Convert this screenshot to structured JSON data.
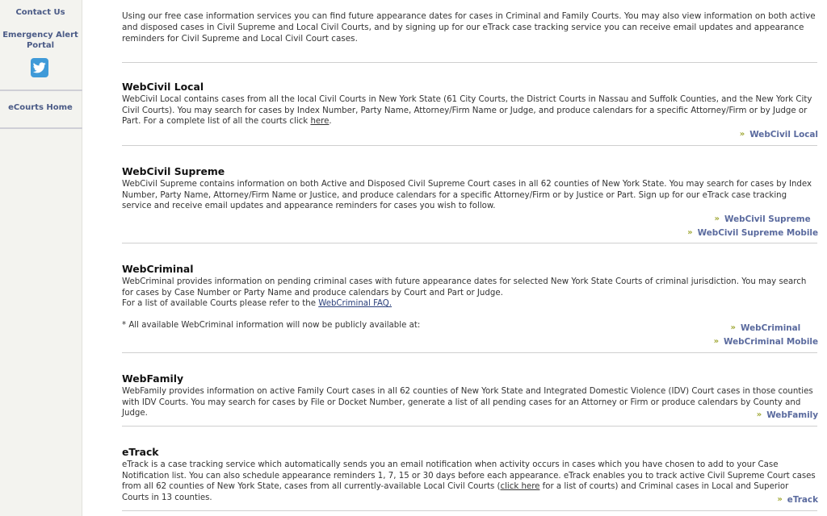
{
  "sidebar": {
    "contact_label": "Contact Us",
    "emergency_label": "Emergency Alert Portal",
    "twitter_icon": "twitter-bird-icon",
    "ecourts_label": "eCourts Home"
  },
  "intro_text": "Using our free case information services you can find future appearance dates for cases in Criminal and Family Courts. You may also view information on both active and disposed cases in Civil Supreme and Local Civil Courts, and by signing up for our eTrack case tracking service you can receive email updates and appearance reminders for Civil Supreme and Local Civil Court cases.",
  "sections": {
    "webcivil_local": {
      "title": "WebCivil Local",
      "body": "WebCivil Local contains cases from all the local Civil Courts in New York State (61 City Courts, the District Courts in Nassau and Suffolk Counties, and the New York City Civil Courts). You may search for cases by Index Number, Party Name, Attorney/Firm Name or Judge, and produce calendars for a specific Attorney/Firm or by Judge or Part. For a complete list of all the courts click ",
      "here_link": "here",
      "body_end": ".",
      "links": [
        "WebCivil Local"
      ]
    },
    "webcivil_supreme": {
      "title": "WebCivil Supreme",
      "body": "WebCivil Supreme contains information on both Active and Disposed Civil Supreme Court cases in all 62 counties of New York State. You may search for cases by Index Number, Party Name, Attorney/Firm Name or Justice, and produce calendars for a specific Attorney/Firm or by Justice or Part. Sign up for our eTrack case tracking service and receive email updates and appearance reminders for cases you wish to follow.",
      "links": [
        "WebCivil Supreme",
        "WebCivil Supreme Mobile"
      ]
    },
    "webcriminal": {
      "title": "WebCriminal",
      "body": "WebCriminal provides information on pending criminal cases with future appearance dates for selected New York State Courts of criminal jurisdiction. You may search for cases by Case Number or Party Name and produce calendars by Court and Part or Judge.",
      "faq_prefix": "For a list of available Courts please refer to the ",
      "faq_link": "WebCriminal FAQ.",
      "note": "* All available WebCriminal information will now be publicly available at:",
      "links": [
        "WebCriminal",
        "WebCriminal Mobile"
      ]
    },
    "webfamily": {
      "title": "WebFamily",
      "body": "WebFamily provides information on active Family Court cases in all 62 counties of New York State and Integrated Domestic Violence (IDV) Court cases in those counties with IDV Courts. You may search for cases by File or Docket Number, generate a list of all pending cases for an Attorney or Firm or produce calendars by County and Judge.",
      "links": [
        "WebFamily"
      ]
    },
    "etrack": {
      "title": "eTrack",
      "body": "eTrack is a case tracking service which automatically sends you an email notification when activity occurs in cases which you have chosen to add to your Case Notification list. You can also schedule appearance reminders 1, 7, 15 or 30 days before each appearance. eTrack enables you to track active Civil Supreme Court cases from all 62 counties of New York State, cases from all currently-available Local Civil Courts (",
      "click_here_link": "click here",
      "body_end": " for a list of courts) and Criminal cases in Local and Superior Courts in 13 counties.",
      "links": [
        "eTrack"
      ]
    }
  },
  "chevron": "»",
  "colors": {
    "link": "#5a6a9e",
    "chevron": "#a0a836",
    "sidebar_bg": "#f3f3ef",
    "twitter": "#3f9ad8"
  }
}
